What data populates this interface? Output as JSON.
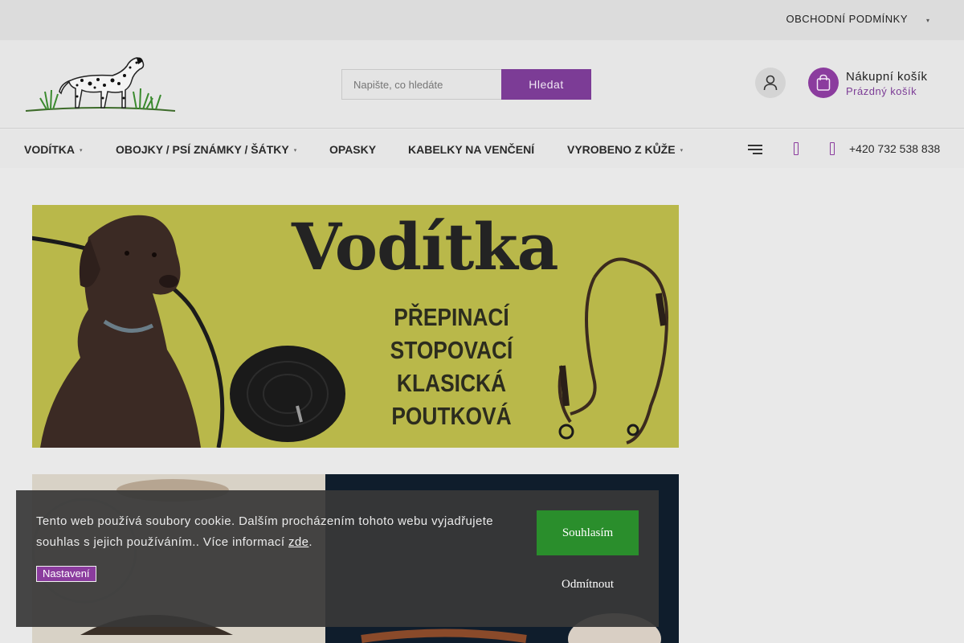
{
  "topbar": {
    "link_label": "OBCHODNÍ PODMÍNKY"
  },
  "search": {
    "placeholder": "Napište, co hledáte",
    "button_label": "Hledat"
  },
  "cart": {
    "title": "Nákupní košík",
    "status": "Prázdný košík"
  },
  "nav": {
    "items": [
      {
        "label": "VODÍTKA",
        "has_submenu": true
      },
      {
        "label": "OBOJKY / PSÍ ZNÁMKY / ŠÁTKY",
        "has_submenu": true
      },
      {
        "label": "OPASKY",
        "has_submenu": false
      },
      {
        "label": "KABELKY NA VENČENÍ",
        "has_submenu": false
      },
      {
        "label": "VYROBENO Z KŮŽE",
        "has_submenu": true
      }
    ],
    "phone": "+420 732 538 838"
  },
  "banner": {
    "title": "Vodítka",
    "lines": [
      "PŘEPINACÍ",
      "STOPOVACÍ",
      "KLASICKÁ",
      "POUTKOVÁ"
    ]
  },
  "cookie": {
    "text_main": "Tento web používá soubory cookie. Dalším procházením tohoto webu vyjadřujete souhlas s jejich používáním.. Více informací ",
    "link_label": "zde",
    "text_end": ".",
    "settings_label": "Nastavení",
    "accept_label": "Souhlasím",
    "reject_label": "Odmítnout"
  },
  "icons": {
    "user": "user-icon",
    "cart": "shopping-bag-icon",
    "menu": "hamburger-icon",
    "chevron": "chevron-down-icon"
  },
  "colors": {
    "brand_purple": "#7c3c96",
    "accept_green": "#2a8e2c",
    "banner_yellow": "#b9b84a"
  }
}
